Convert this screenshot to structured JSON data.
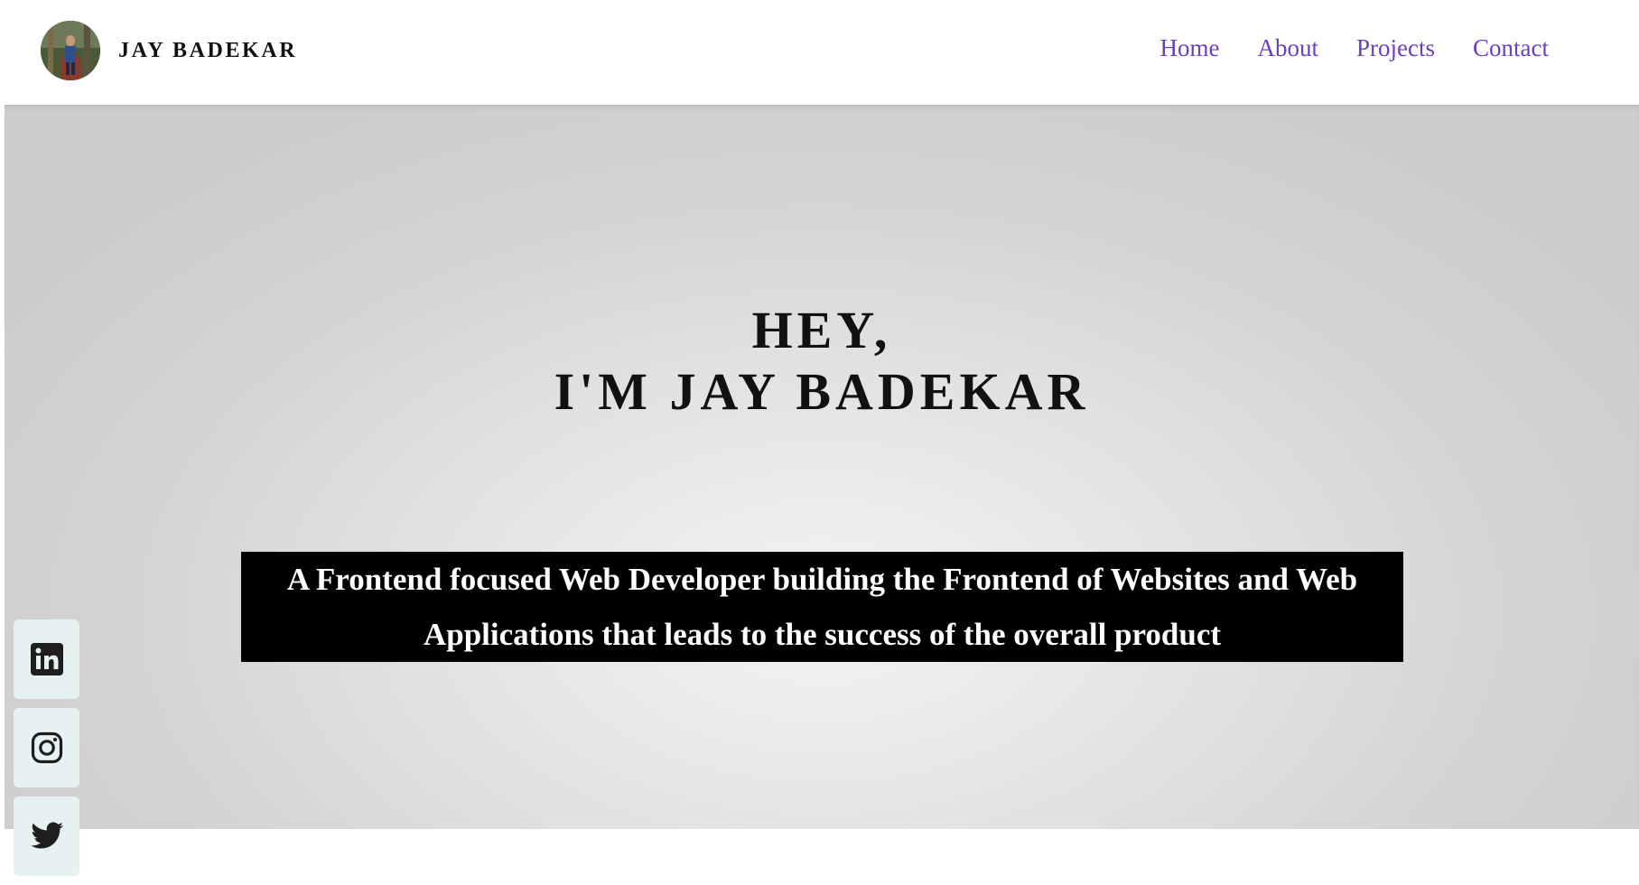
{
  "brand": {
    "name": "JAY BADEKAR"
  },
  "nav": {
    "items": [
      {
        "label": "Home"
      },
      {
        "label": "About"
      },
      {
        "label": "Projects"
      },
      {
        "label": "Contact"
      }
    ]
  },
  "hero": {
    "greeting": "HEY,",
    "headline": "I'M JAY BADEKAR",
    "tagline": "A Frontend focused Web Developer building the Frontend of Websites and Web Applications that leads to the success of the overall product"
  },
  "socials": [
    {
      "icon": "linkedin-icon"
    },
    {
      "icon": "instagram-icon"
    },
    {
      "icon": "twitter-icon"
    }
  ],
  "colors": {
    "nav_link": "#6b3fbf",
    "tagline_bg": "#000000",
    "tagline_text": "#ffffff",
    "social_bg": "#e6f2f2"
  }
}
